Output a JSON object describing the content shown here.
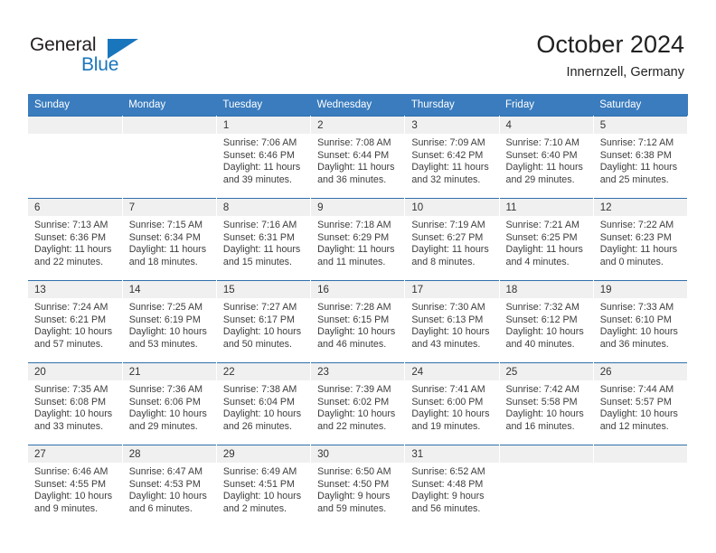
{
  "brand": {
    "name_top": "General",
    "name_bottom": "Blue",
    "flag_icon": "triangle-flag-icon",
    "color_dark": "#231f20",
    "color_blue": "#1a76bc"
  },
  "header": {
    "title": "October 2024",
    "subtitle": "Innernzell, Germany"
  },
  "theme": {
    "header_bar": "#3a7cbe",
    "row_divider": "#2f6fad",
    "daynum_strip": "#f0f0f0",
    "text": "#3d3d3d"
  },
  "columns": [
    "Sunday",
    "Monday",
    "Tuesday",
    "Wednesday",
    "Thursday",
    "Friday",
    "Saturday"
  ],
  "labels": {
    "sunrise_prefix": "Sunrise:",
    "sunset_prefix": "Sunset:",
    "daylight_prefix": "Daylight:"
  },
  "weeks": [
    [
      {
        "empty": true
      },
      {
        "empty": true
      },
      {
        "day": "1",
        "sunrise": "Sunrise: 7:06 AM",
        "sunset": "Sunset: 6:46 PM",
        "daylight_1": "Daylight: 11 hours",
        "daylight_2": "and 39 minutes."
      },
      {
        "day": "2",
        "sunrise": "Sunrise: 7:08 AM",
        "sunset": "Sunset: 6:44 PM",
        "daylight_1": "Daylight: 11 hours",
        "daylight_2": "and 36 minutes."
      },
      {
        "day": "3",
        "sunrise": "Sunrise: 7:09 AM",
        "sunset": "Sunset: 6:42 PM",
        "daylight_1": "Daylight: 11 hours",
        "daylight_2": "and 32 minutes."
      },
      {
        "day": "4",
        "sunrise": "Sunrise: 7:10 AM",
        "sunset": "Sunset: 6:40 PM",
        "daylight_1": "Daylight: 11 hours",
        "daylight_2": "and 29 minutes."
      },
      {
        "day": "5",
        "sunrise": "Sunrise: 7:12 AM",
        "sunset": "Sunset: 6:38 PM",
        "daylight_1": "Daylight: 11 hours",
        "daylight_2": "and 25 minutes."
      }
    ],
    [
      {
        "day": "6",
        "sunrise": "Sunrise: 7:13 AM",
        "sunset": "Sunset: 6:36 PM",
        "daylight_1": "Daylight: 11 hours",
        "daylight_2": "and 22 minutes."
      },
      {
        "day": "7",
        "sunrise": "Sunrise: 7:15 AM",
        "sunset": "Sunset: 6:34 PM",
        "daylight_1": "Daylight: 11 hours",
        "daylight_2": "and 18 minutes."
      },
      {
        "day": "8",
        "sunrise": "Sunrise: 7:16 AM",
        "sunset": "Sunset: 6:31 PM",
        "daylight_1": "Daylight: 11 hours",
        "daylight_2": "and 15 minutes."
      },
      {
        "day": "9",
        "sunrise": "Sunrise: 7:18 AM",
        "sunset": "Sunset: 6:29 PM",
        "daylight_1": "Daylight: 11 hours",
        "daylight_2": "and 11 minutes."
      },
      {
        "day": "10",
        "sunrise": "Sunrise: 7:19 AM",
        "sunset": "Sunset: 6:27 PM",
        "daylight_1": "Daylight: 11 hours",
        "daylight_2": "and 8 minutes."
      },
      {
        "day": "11",
        "sunrise": "Sunrise: 7:21 AM",
        "sunset": "Sunset: 6:25 PM",
        "daylight_1": "Daylight: 11 hours",
        "daylight_2": "and 4 minutes."
      },
      {
        "day": "12",
        "sunrise": "Sunrise: 7:22 AM",
        "sunset": "Sunset: 6:23 PM",
        "daylight_1": "Daylight: 11 hours",
        "daylight_2": "and 0 minutes."
      }
    ],
    [
      {
        "day": "13",
        "sunrise": "Sunrise: 7:24 AM",
        "sunset": "Sunset: 6:21 PM",
        "daylight_1": "Daylight: 10 hours",
        "daylight_2": "and 57 minutes."
      },
      {
        "day": "14",
        "sunrise": "Sunrise: 7:25 AM",
        "sunset": "Sunset: 6:19 PM",
        "daylight_1": "Daylight: 10 hours",
        "daylight_2": "and 53 minutes."
      },
      {
        "day": "15",
        "sunrise": "Sunrise: 7:27 AM",
        "sunset": "Sunset: 6:17 PM",
        "daylight_1": "Daylight: 10 hours",
        "daylight_2": "and 50 minutes."
      },
      {
        "day": "16",
        "sunrise": "Sunrise: 7:28 AM",
        "sunset": "Sunset: 6:15 PM",
        "daylight_1": "Daylight: 10 hours",
        "daylight_2": "and 46 minutes."
      },
      {
        "day": "17",
        "sunrise": "Sunrise: 7:30 AM",
        "sunset": "Sunset: 6:13 PM",
        "daylight_1": "Daylight: 10 hours",
        "daylight_2": "and 43 minutes."
      },
      {
        "day": "18",
        "sunrise": "Sunrise: 7:32 AM",
        "sunset": "Sunset: 6:12 PM",
        "daylight_1": "Daylight: 10 hours",
        "daylight_2": "and 40 minutes."
      },
      {
        "day": "19",
        "sunrise": "Sunrise: 7:33 AM",
        "sunset": "Sunset: 6:10 PM",
        "daylight_1": "Daylight: 10 hours",
        "daylight_2": "and 36 minutes."
      }
    ],
    [
      {
        "day": "20",
        "sunrise": "Sunrise: 7:35 AM",
        "sunset": "Sunset: 6:08 PM",
        "daylight_1": "Daylight: 10 hours",
        "daylight_2": "and 33 minutes."
      },
      {
        "day": "21",
        "sunrise": "Sunrise: 7:36 AM",
        "sunset": "Sunset: 6:06 PM",
        "daylight_1": "Daylight: 10 hours",
        "daylight_2": "and 29 minutes."
      },
      {
        "day": "22",
        "sunrise": "Sunrise: 7:38 AM",
        "sunset": "Sunset: 6:04 PM",
        "daylight_1": "Daylight: 10 hours",
        "daylight_2": "and 26 minutes."
      },
      {
        "day": "23",
        "sunrise": "Sunrise: 7:39 AM",
        "sunset": "Sunset: 6:02 PM",
        "daylight_1": "Daylight: 10 hours",
        "daylight_2": "and 22 minutes."
      },
      {
        "day": "24",
        "sunrise": "Sunrise: 7:41 AM",
        "sunset": "Sunset: 6:00 PM",
        "daylight_1": "Daylight: 10 hours",
        "daylight_2": "and 19 minutes."
      },
      {
        "day": "25",
        "sunrise": "Sunrise: 7:42 AM",
        "sunset": "Sunset: 5:58 PM",
        "daylight_1": "Daylight: 10 hours",
        "daylight_2": "and 16 minutes."
      },
      {
        "day": "26",
        "sunrise": "Sunrise: 7:44 AM",
        "sunset": "Sunset: 5:57 PM",
        "daylight_1": "Daylight: 10 hours",
        "daylight_2": "and 12 minutes."
      }
    ],
    [
      {
        "day": "27",
        "sunrise": "Sunrise: 6:46 AM",
        "sunset": "Sunset: 4:55 PM",
        "daylight_1": "Daylight: 10 hours",
        "daylight_2": "and 9 minutes."
      },
      {
        "day": "28",
        "sunrise": "Sunrise: 6:47 AM",
        "sunset": "Sunset: 4:53 PM",
        "daylight_1": "Daylight: 10 hours",
        "daylight_2": "and 6 minutes."
      },
      {
        "day": "29",
        "sunrise": "Sunrise: 6:49 AM",
        "sunset": "Sunset: 4:51 PM",
        "daylight_1": "Daylight: 10 hours",
        "daylight_2": "and 2 minutes."
      },
      {
        "day": "30",
        "sunrise": "Sunrise: 6:50 AM",
        "sunset": "Sunset: 4:50 PM",
        "daylight_1": "Daylight: 9 hours",
        "daylight_2": "and 59 minutes."
      },
      {
        "day": "31",
        "sunrise": "Sunrise: 6:52 AM",
        "sunset": "Sunset: 4:48 PM",
        "daylight_1": "Daylight: 9 hours",
        "daylight_2": "and 56 minutes."
      },
      {
        "empty": true
      },
      {
        "empty": true
      }
    ]
  ]
}
